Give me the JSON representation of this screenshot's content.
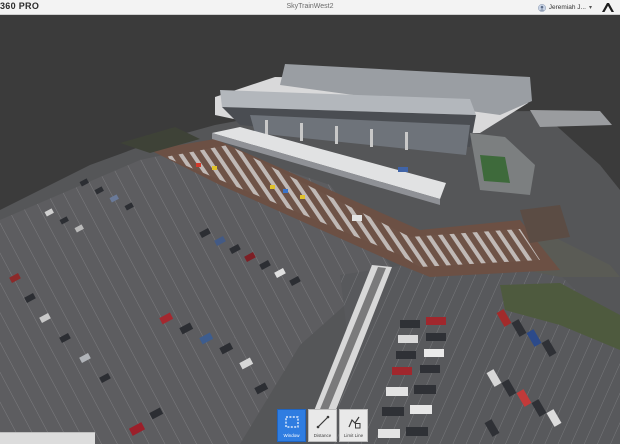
{
  "app": {
    "brand": "360 PRO",
    "title": "SkyTrainWest2"
  },
  "user": {
    "name": "Jeremiah J...",
    "avatar_icon": "user-avatar-icon",
    "menu_icon": "chevron-down-icon"
  },
  "logo": {
    "icon": "company-logo-icon"
  },
  "viewport": {
    "scene": "3d-model-view"
  },
  "toolbar": {
    "tools": [
      {
        "label": "Window",
        "icon": "window-select-icon",
        "active": true
      },
      {
        "label": "Distance",
        "icon": "distance-measure-icon",
        "active": false
      },
      {
        "label": "Limit Line",
        "icon": "limit-line-icon",
        "active": false
      }
    ]
  },
  "colors": {
    "accent": "#2f7de1",
    "background": "#3b3b3b"
  }
}
